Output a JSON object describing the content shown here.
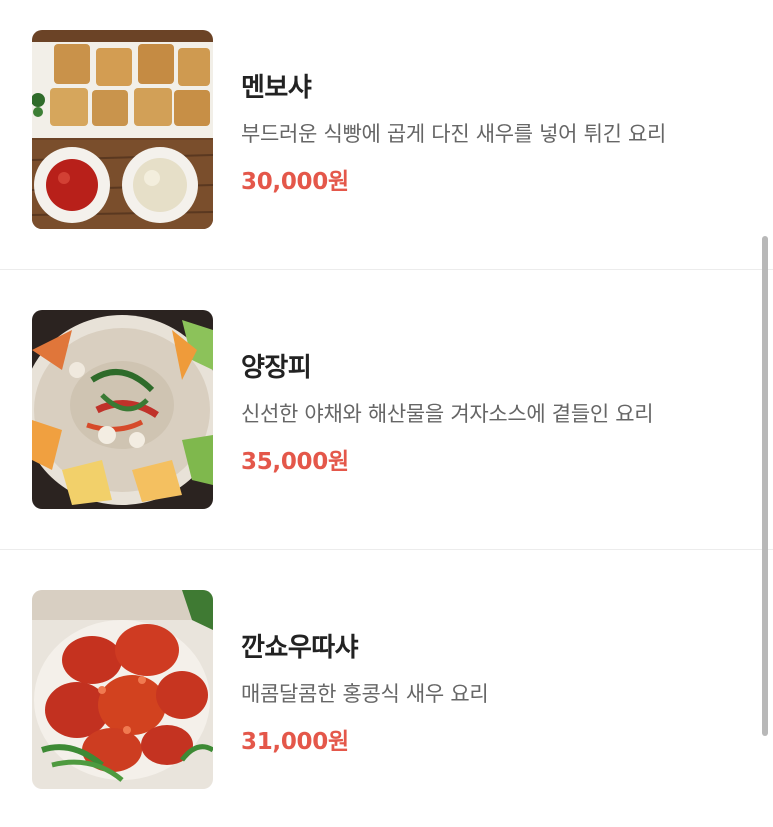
{
  "menu": {
    "items": [
      {
        "name": "멘보샤",
        "description": "부드러운 식빵에 곱게 다진 새우를 넣어 튀긴 요리",
        "price": "30,000원",
        "image_icon": "menbosha-photo"
      },
      {
        "name": "양장피",
        "description": "신선한 야채와 해산물을 겨자소스에 곁들인 요리",
        "price": "35,000원",
        "image_icon": "yangjangpi-photo"
      },
      {
        "name": "깐쇼우따샤",
        "description": "매콤달콤한 홍콩식 새우 요리",
        "price": "31,000원",
        "image_icon": "kkanshou-shrimp-photo"
      }
    ]
  },
  "colors": {
    "price": "#e4574a",
    "title": "#222222",
    "description": "#666666",
    "divider": "#ececec"
  }
}
